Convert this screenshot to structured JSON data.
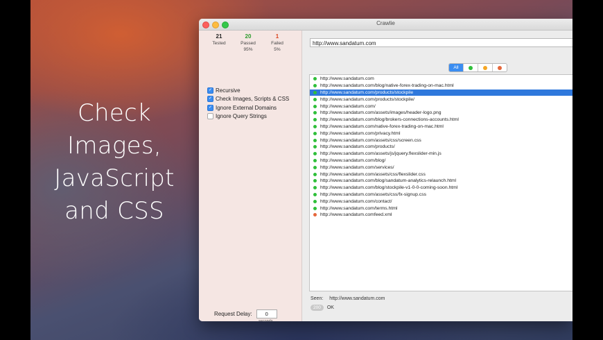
{
  "tagline": [
    "Check",
    "Images,",
    "JavaScript",
    "and CSS"
  ],
  "window": {
    "title": "Crawlie"
  },
  "stats": {
    "tested": {
      "value": "21",
      "label": "Tested"
    },
    "passed": {
      "value": "20",
      "label": "Passed",
      "percent": "95%"
    },
    "failed": {
      "value": "1",
      "label": "Failed",
      "percent": "5%"
    }
  },
  "options": [
    {
      "label": "Recursive",
      "checked": true
    },
    {
      "label": "Check Images, Scripts & CSS",
      "checked": true
    },
    {
      "label": "Ignore External Domains",
      "checked": true
    },
    {
      "label": "Ignore Query Strings",
      "checked": false
    }
  ],
  "delay": {
    "label": "Request Delay:",
    "value": "0",
    "unit": "seconds"
  },
  "url_field": {
    "value": "http://www.sandatum.com"
  },
  "filter": {
    "all_label": "All",
    "selected": "All",
    "icons": [
      "green-dot",
      "orange-dot",
      "red-dot"
    ]
  },
  "colors": {
    "green": "#2fbf3a",
    "orange": "#f5a623",
    "red": "#e5673b",
    "accent": "#3b8df1"
  },
  "urls": [
    {
      "url": "http://www.sandatum.com",
      "status": "green"
    },
    {
      "url": "http://www.sandatum.com/blog/native-forex-trading-on-mac.html",
      "status": "green"
    },
    {
      "url": "http://www.sandatum.com/products/stockpile",
      "status": "green",
      "selected": true
    },
    {
      "url": "http://www.sandatum.com/products/stockpile/",
      "status": "green"
    },
    {
      "url": "http://www.sandatum.com/",
      "status": "green"
    },
    {
      "url": "http://www.sandatum.com/assets/images/header-logo.png",
      "status": "green"
    },
    {
      "url": "http://www.sandatum.com/blog/brokers-connections-accounts.html",
      "status": "green"
    },
    {
      "url": "http://www.sandatum.com/native-forex-trading-on-mac.html",
      "status": "green"
    },
    {
      "url": "http://www.sandatum.com/privacy.html",
      "status": "green"
    },
    {
      "url": "http://www.sandatum.com/assets/css/screen.css",
      "status": "green"
    },
    {
      "url": "http://www.sandatum.com/products/",
      "status": "green"
    },
    {
      "url": "http://www.sandatum.com/assets/js/jquery.flexslider-min.js",
      "status": "green"
    },
    {
      "url": "http://www.sandatum.com/blog/",
      "status": "green"
    },
    {
      "url": "http://www.sandatum.com/services/",
      "status": "green"
    },
    {
      "url": "http://www.sandatum.com/assets/css/flexslider.css",
      "status": "green"
    },
    {
      "url": "http://www.sandatum.com/blog/sandatum-analytics-relaunch.html",
      "status": "green"
    },
    {
      "url": "http://www.sandatum.com/blog/stockpile-v1-0-0-coming-soon.html",
      "status": "green"
    },
    {
      "url": "http://www.sandatum.com/assets/css/fx-signup.css",
      "status": "green"
    },
    {
      "url": "http://www.sandatum.com/contact/",
      "status": "green"
    },
    {
      "url": "http://www.sandatum.com/terms.html",
      "status": "green"
    },
    {
      "url": "http://www.sandatum.comfeed.xml",
      "status": "red"
    }
  ],
  "detail": {
    "seen_label": "Seen:",
    "seen_value": "http://www.sandatum.com",
    "status_code": "200",
    "status_text": "OK"
  }
}
